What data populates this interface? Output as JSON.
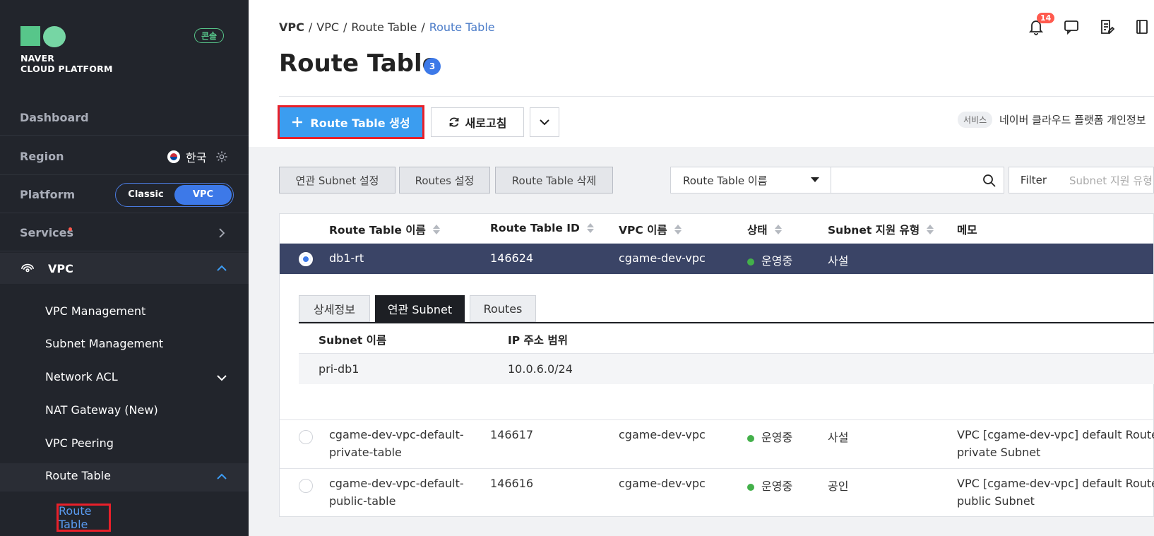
{
  "brand": {
    "line1": "NAVER",
    "line2": "CLOUD PLATFORM",
    "console_label": "콘솔"
  },
  "sidebar": {
    "dashboard": "Dashboard",
    "region_label": "Region",
    "region_value": "한국",
    "platform_label": "Platform",
    "platform_options": [
      "Classic",
      "VPC"
    ],
    "services": "Services",
    "vpc": "VPC",
    "items": [
      "VPC Management",
      "Subnet Management",
      "Network ACL",
      "NAT Gateway (New)",
      "VPC Peering",
      "Route Table"
    ],
    "active_leaf": "Route Table"
  },
  "header": {
    "breadcrumb": [
      "VPC",
      "VPC",
      "Route Table",
      "Route Table"
    ],
    "title": "Route Table",
    "count": "3",
    "notifications": "14"
  },
  "toolbar": {
    "create": "Route Table 생성",
    "refresh": "새로고침",
    "service_tag": "서비스",
    "service_text": "네이버 클라우드 플랫폼 개인정보"
  },
  "actions": {
    "subnet_setting": "연관 Subnet 설정",
    "routes_setting": "Routes 설정",
    "delete": "Route Table 삭제",
    "search_select": "Route Table 이름",
    "filter": "Filter",
    "filter_placeholder": "Subnet 지원 유형"
  },
  "table": {
    "columns": [
      "Route Table 이름",
      "Route Table ID",
      "VPC 이름",
      "상태",
      "Subnet 지원 유형",
      "메모"
    ],
    "selected_row": {
      "name": "db1-rt",
      "id": "146624",
      "vpc": "cgame-dev-vpc",
      "status": "운영중",
      "type": "사설"
    },
    "detail_tabs": [
      "상세정보",
      "연관 Subnet",
      "Routes"
    ],
    "detail_columns": [
      "Subnet 이름",
      "IP 주소 범위"
    ],
    "detail_row": {
      "subnet": "pri-db1",
      "ip": "10.0.6.0/24"
    },
    "rows": [
      {
        "name_line1": "cgame-dev-vpc-default-",
        "name_line2": "private-table",
        "id": "146617",
        "vpc": "cgame-dev-vpc",
        "status": "운영중",
        "type": "사설",
        "memo_line1": "VPC [cgame-dev-vpc] default Route Ta",
        "memo_line2": "private Subnet"
      },
      {
        "name_line1": "cgame-dev-vpc-default-",
        "name_line2": "public-table",
        "id": "146616",
        "vpc": "cgame-dev-vpc",
        "status": "운영중",
        "type": "공인",
        "memo_line1": "VPC [cgame-dev-vpc] default Route Ta",
        "memo_line2": "public Subnet"
      }
    ]
  }
}
